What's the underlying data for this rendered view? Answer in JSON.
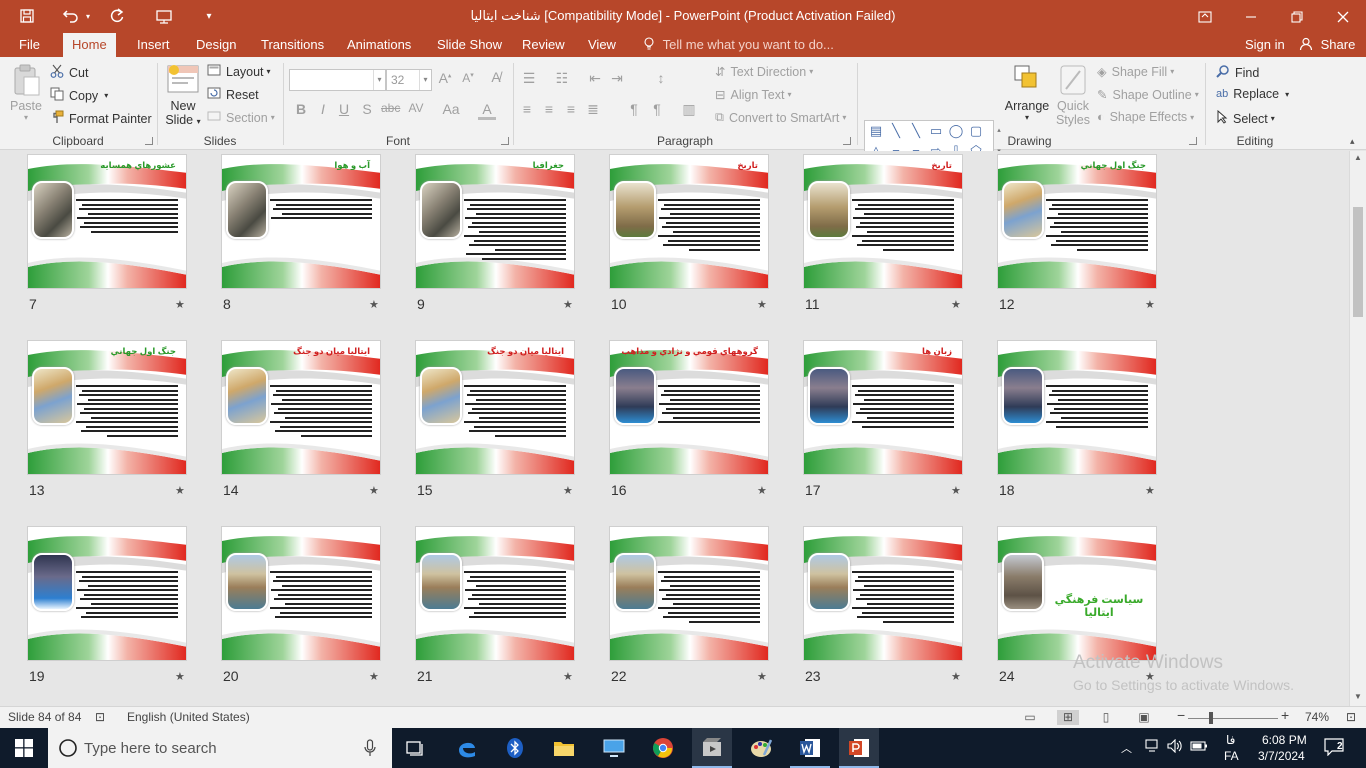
{
  "window": {
    "title": "شناخت ایتالیا  [Compatibility Mode] - PowerPoint (Product Activation Failed)"
  },
  "ribbon_tabs": [
    "File",
    "Home",
    "Insert",
    "Design",
    "Transitions",
    "Animations",
    "Slide Show",
    "Review",
    "View"
  ],
  "active_tab": "Home",
  "tell_me": "Tell me what you want to do...",
  "signin": "Sign in",
  "share": "Share",
  "clipboard": {
    "label": "Clipboard",
    "paste": "Paste",
    "cut": "Cut",
    "copy": "Copy",
    "format_painter": "Format Painter"
  },
  "slides_group": {
    "label": "Slides",
    "new_slide_line1": "New",
    "new_slide_line2": "Slide",
    "layout": "Layout",
    "reset": "Reset",
    "section": "Section"
  },
  "font_group": {
    "label": "Font",
    "font_name": "",
    "font_size": "32"
  },
  "paragraph_group": {
    "label": "Paragraph",
    "text_direction": "Text Direction",
    "align_text": "Align Text",
    "convert_smartart": "Convert to SmartArt"
  },
  "drawing_group": {
    "label": "Drawing",
    "arrange": "Arrange",
    "quick_styles_line1": "Quick",
    "quick_styles_line2": "Styles",
    "shape_fill": "Shape Fill",
    "shape_outline": "Shape Outline",
    "shape_effects": "Shape Effects"
  },
  "editing_group": {
    "label": "Editing",
    "find": "Find",
    "replace": "Replace",
    "select": "Select"
  },
  "slides": [
    {
      "num": "7",
      "title": "عشورهاي همسايه",
      "title_color": "#2a9a2a",
      "pic": "map",
      "lines": 8
    },
    {
      "num": "8",
      "title": "آب و هوا",
      "title_color": "#2a9a2a",
      "pic": "map",
      "lines": 5
    },
    {
      "num": "9",
      "title": "جغرافيا",
      "title_color": "#2a9a2a",
      "pic": "map",
      "lines": 14
    },
    {
      "num": "10",
      "title": "تاريخ",
      "title_color": "#d02020",
      "pic": "colosseum",
      "lines": 12
    },
    {
      "num": "11",
      "title": "تاريخ",
      "title_color": "#d02020",
      "pic": "colosseum",
      "lines": 12
    },
    {
      "num": "12",
      "title": "جنگ اول جهاني",
      "title_color": "#2a9a2a",
      "pic": "italy",
      "lines": 12
    },
    {
      "num": "13",
      "title": "جنگ اول جهاني",
      "title_color": "#2a9a2a",
      "pic": "italy",
      "lines": 12
    },
    {
      "num": "14",
      "title": "ايتاليا ميان دو جنگ",
      "title_color": "#d02020",
      "pic": "italy",
      "lines": 12
    },
    {
      "num": "15",
      "title": "ايتاليا ميان دو جنگ",
      "title_color": "#d02020",
      "pic": "italy",
      "lines": 12
    },
    {
      "num": "16",
      "title": "گروههاي قومي و نژادي و مذاهب",
      "title_color": "#d02020",
      "pic": "fountain",
      "lines": 9
    },
    {
      "num": "17",
      "title": "زبان ها",
      "title_color": "#d02020",
      "pic": "fountain",
      "lines": 10
    },
    {
      "num": "18",
      "title": "",
      "title_color": "#d02020",
      "pic": "fountain",
      "lines": 10
    },
    {
      "num": "19",
      "title": "",
      "title_color": "#d02020",
      "pic": "fountain2",
      "lines": 11
    },
    {
      "num": "20",
      "title": "",
      "title_color": "#d02020",
      "pic": "venice",
      "lines": 11
    },
    {
      "num": "21",
      "title": "",
      "title_color": "#d02020",
      "pic": "venice",
      "lines": 11
    },
    {
      "num": "22",
      "title": "",
      "title_color": "#d02020",
      "pic": "venice",
      "lines": 12
    },
    {
      "num": "23",
      "title": "",
      "title_color": "#d02020",
      "pic": "venice",
      "lines": 12
    },
    {
      "num": "24",
      "title": "",
      "title_color": "#d02020",
      "pic": "rome",
      "lines": 0,
      "center_title": "سياست فرهنگي ايتاليا"
    }
  ],
  "watermark": {
    "line1": "Activate Windows",
    "line2": "Go to Settings to activate Windows."
  },
  "status": {
    "slide_info": "Slide 84 of 84",
    "language": "English (United States)",
    "zoom": "74%",
    "zoom_level_fraction": 0.25
  },
  "taskbar": {
    "search_placeholder": "Type here to search",
    "time": "6:08 PM",
    "date": "3/7/2024",
    "lang_top": "فا",
    "lang_bottom": "FA",
    "notif_count": "2"
  },
  "colors": {
    "accent": "#b7472a",
    "green": "#3aaa2b",
    "red": "#e0241b"
  }
}
